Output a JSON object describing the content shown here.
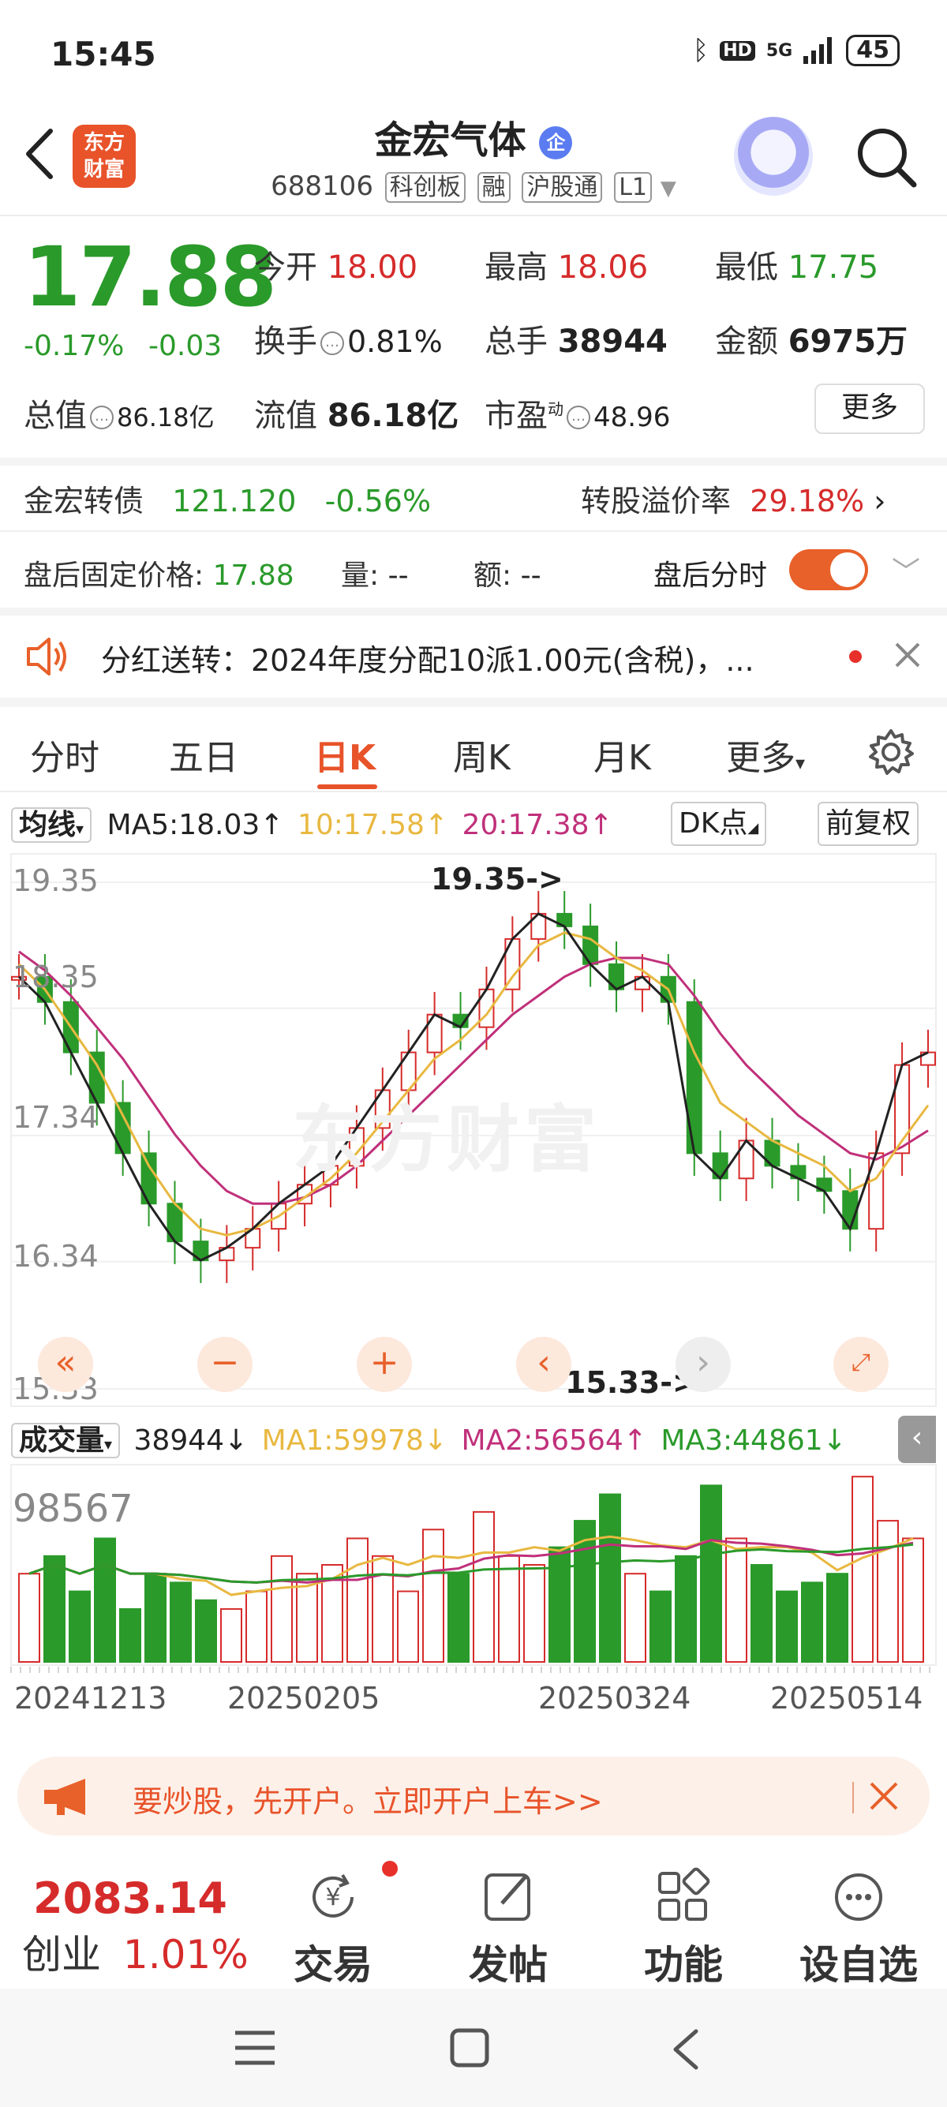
{
  "status_bar": {
    "time": "15:45",
    "network": "5G",
    "hd": "HD",
    "battery": "45"
  },
  "header": {
    "title": "金宏气体",
    "title_badge": "企",
    "code": "688106",
    "tags": [
      "科创板",
      "融",
      "沪股通",
      "L1"
    ],
    "logo_line1": "东方",
    "logo_line2": "财富"
  },
  "quote": {
    "price": "17.88",
    "change_pct": "-0.17%",
    "change": "-0.03",
    "open_label": "今开",
    "open": "18.00",
    "high_label": "最高",
    "high": "18.06",
    "low_label": "最低",
    "low": "17.75",
    "turnover_label": "换手",
    "turnover": "0.81%",
    "volume_label": "总手",
    "volume": "38944",
    "amount_label": "金额",
    "amount": "6975万",
    "mktcap_label": "总值",
    "mktcap": "86.18亿",
    "float_label": "流值",
    "float": "86.18亿",
    "pe_label": "市盈",
    "pe_sup": "动",
    "pe": "48.96",
    "more_label": "更多"
  },
  "bond": {
    "name": "金宏转债",
    "price": "121.120",
    "change": "-0.56%",
    "premium_label": "转股溢价率",
    "premium": "29.18%"
  },
  "after_hours": {
    "price_label": "盘后固定价格:",
    "price": "17.88",
    "vol_label": "量:",
    "vol": "--",
    "amt_label": "额:",
    "amt": "--",
    "toggle_label": "盘后分时",
    "toggle_on": true
  },
  "notice": {
    "text": "分红送转：2024年度分配10派1.00元(含税)，..."
  },
  "tabs": [
    {
      "label": "分时"
    },
    {
      "label": "五日"
    },
    {
      "label": "日K"
    },
    {
      "label": "周K"
    },
    {
      "label": "月K"
    },
    {
      "label": "更多"
    }
  ],
  "active_tab": "日K",
  "ma_bar": {
    "indicator": "均线",
    "ma5": "MA5:18.03",
    "ma10": "10:17.58",
    "ma20": "20:17.38",
    "dk": "DK点",
    "adjust": "前复权"
  },
  "chart_data": {
    "type": "candlestick",
    "y_ticks": [
      "19.35",
      "18.35",
      "17.34",
      "16.34",
      "15.33"
    ],
    "ylim": [
      15.33,
      19.35
    ],
    "max_annotation": "19.35->",
    "min_annotation": "15.33->",
    "watermark": "东方财富",
    "colors": {
      "up": "#d62b2b",
      "down": "#2a9a2a",
      "ma5": "#222222",
      "ma10": "#e8b840",
      "ma20": "#c0307a"
    },
    "x_ticks": [
      "20241213",
      "20250205",
      "20250324",
      "20250514"
    ],
    "ma5_series": [
      18.6,
      18.4,
      18.0,
      17.6,
      17.2,
      16.8,
      16.5,
      16.35,
      16.45,
      16.6,
      16.8,
      16.95,
      17.1,
      17.4,
      17.7,
      18.0,
      18.3,
      18.2,
      18.5,
      18.9,
      19.1,
      19.0,
      18.7,
      18.5,
      18.6,
      18.4,
      17.2,
      17.0,
      17.3,
      17.1,
      17.0,
      16.9,
      16.6,
      17.2,
      17.9,
      18.0
    ],
    "ma10_series": [
      18.7,
      18.5,
      18.2,
      17.9,
      17.5,
      17.1,
      16.8,
      16.6,
      16.55,
      16.6,
      16.7,
      16.85,
      17.0,
      17.2,
      17.45,
      17.7,
      17.95,
      18.1,
      18.3,
      18.6,
      18.85,
      18.95,
      18.9,
      18.75,
      18.65,
      18.5,
      18.0,
      17.6,
      17.45,
      17.3,
      17.2,
      17.1,
      16.9,
      17.0,
      17.3,
      17.58
    ],
    "ma20_series": [
      18.8,
      18.65,
      18.45,
      18.2,
      17.95,
      17.65,
      17.35,
      17.1,
      16.9,
      16.8,
      16.8,
      16.85,
      16.95,
      17.1,
      17.3,
      17.5,
      17.7,
      17.9,
      18.1,
      18.3,
      18.45,
      18.6,
      18.7,
      18.75,
      18.75,
      18.7,
      18.45,
      18.15,
      17.9,
      17.7,
      17.5,
      17.35,
      17.2,
      17.15,
      17.25,
      17.38
    ]
  },
  "volume": {
    "indicator": "成交量",
    "value": "38944",
    "ma1": "MA1:59978",
    "ma2": "MA2:56564",
    "ma3": "MA3:44861",
    "max_label": "98567",
    "bars": [
      0.5,
      0.6,
      0.4,
      0.7,
      0.3,
      0.5,
      0.45,
      0.35,
      0.3,
      0.4,
      0.6,
      0.5,
      0.55,
      0.7,
      0.6,
      0.4,
      0.75,
      0.5,
      0.85,
      0.6,
      0.55,
      0.65,
      0.8,
      0.95,
      0.5,
      0.4,
      0.6,
      1.0,
      0.7,
      0.55,
      0.4,
      0.45,
      0.5,
      1.05,
      0.8,
      0.7
    ]
  },
  "banner": {
    "text": "要炒股，先开户。立即开户上车>>"
  },
  "bottom_bar": {
    "index_value": "2083.14",
    "index_name": "创业",
    "index_change": "1.01%",
    "items": [
      {
        "label": "交易",
        "icon": "yen-refresh-icon"
      },
      {
        "label": "发帖",
        "icon": "edit-icon"
      },
      {
        "label": "功能",
        "icon": "grid-icon"
      },
      {
        "label": "设自选",
        "icon": "more-icon"
      }
    ]
  }
}
